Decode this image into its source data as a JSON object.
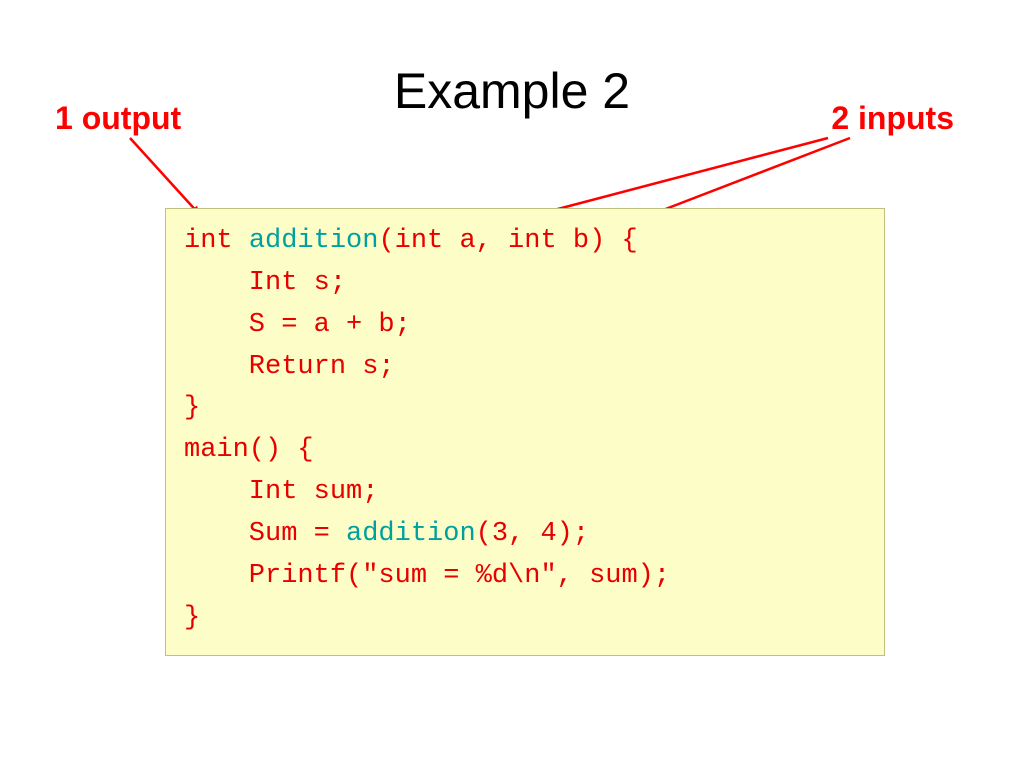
{
  "title": "Example 2",
  "labels": {
    "output": "1 output",
    "inputs": "2 inputs"
  },
  "code": {
    "l1_pre": "int ",
    "l1_fn": "addition",
    "l1_post": "(int a, int b) {",
    "l2": "    Int s;",
    "l3": "    S = a + b;",
    "l4": "    Return s;",
    "l5": "}",
    "l6": "main() {",
    "l7": "    Int sum;",
    "l8_pre": "    Sum = ",
    "l8_fn": "addition",
    "l8_post": "(3, 4);",
    "l9": "    Printf(\"sum = %d\\n\", sum);",
    "l10": "}"
  }
}
